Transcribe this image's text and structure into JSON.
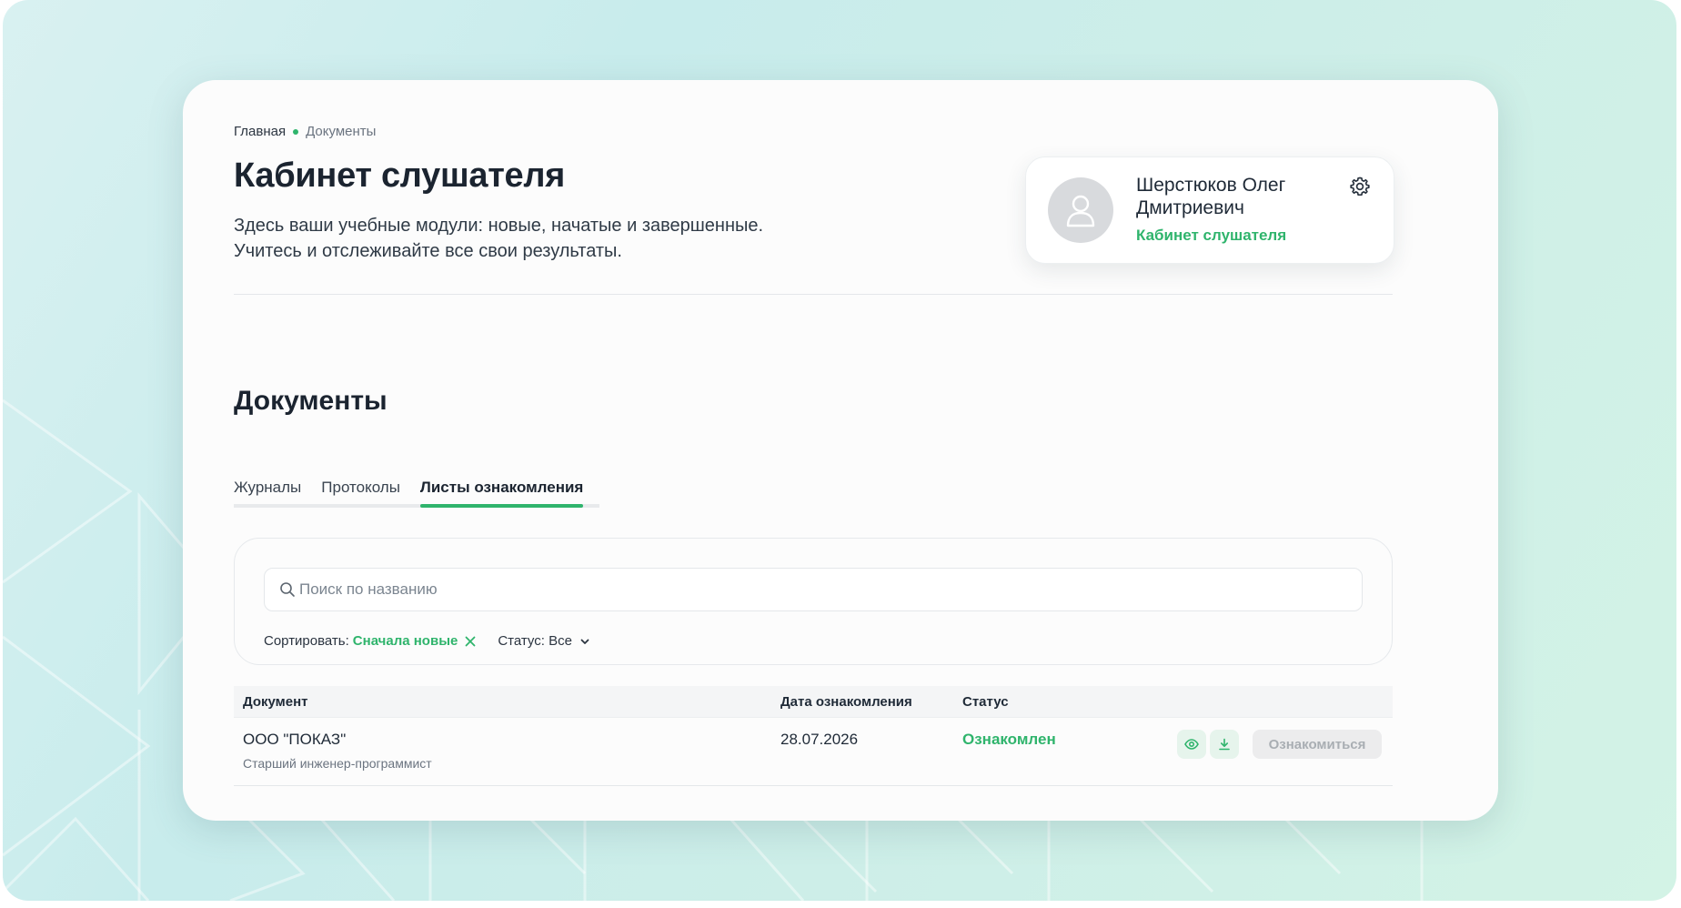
{
  "breadcrumb": {
    "home": "Главная",
    "current": "Документы"
  },
  "header": {
    "title": "Кабинет слушателя",
    "description_line1": "Здесь ваши учебные модули: новые, начатые и завершенные.",
    "description_line2": "Учитесь и отслеживайте все свои результаты."
  },
  "profile": {
    "name": "Шерстюков Олег Дмитриевич",
    "role": "Кабинет слушателя",
    "avatar_icon": "user-icon",
    "settings_icon": "gear-icon"
  },
  "section": {
    "title": "Документы"
  },
  "tabs": [
    {
      "label": "Журналы",
      "active": false
    },
    {
      "label": "Протоколы",
      "active": false
    },
    {
      "label": "Листы ознакомления",
      "active": true
    }
  ],
  "filters": {
    "search_placeholder": "Поиск по названию",
    "search_value": "",
    "sort_label": "Сортировать:",
    "sort_value": "Сначала новые",
    "status_label": "Статус: Все"
  },
  "table": {
    "columns": [
      "Документ",
      "Дата ознакомления",
      "Статус"
    ],
    "rows": [
      {
        "document": "ООО \"ПОКАЗ\"",
        "subtitle": "Старший инженер-программист",
        "date": "28.07.2026",
        "status": "Ознакомлен",
        "action_label": "Ознакомиться"
      }
    ]
  },
  "colors": {
    "accent": "#2fb46c",
    "text": "#1f2a37",
    "muted": "#6b7480"
  }
}
